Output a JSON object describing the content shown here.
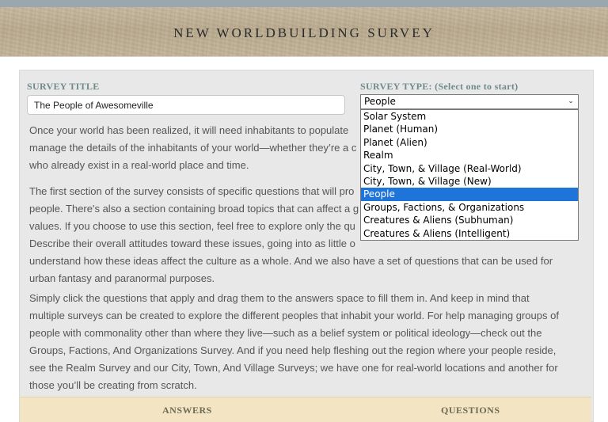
{
  "header": {
    "title": "NEW WORLDBUILDING SURVEY"
  },
  "form": {
    "survey_title_label": "SURVEY TITLE",
    "survey_title_value": "The People of Awesomeville",
    "survey_type_label": "SURVEY TYPE: (Select one to start)",
    "survey_type_value": "People",
    "survey_type_options": [
      "Solar System",
      "Planet (Human)",
      "Planet (Alien)",
      "Realm",
      "City, Town, & Village (Real-World)",
      "City, Town, & Village (New)",
      "People",
      "Groups, Factions, & Organizations",
      "Creatures & Aliens (Subhuman)",
      "Creatures & Aliens (Intelligent)"
    ]
  },
  "intro": {
    "p1": [
      "Once your world has been realized, it will need inhabitants to populate",
      "manage the details of the inhabitants of your world—whether they’re a c",
      "who already exist in a real-world place and time."
    ],
    "p2": [
      "The first section of the survey consists of specific questions that will pro",
      "people. There's also a section containing broad topics that can affect a g",
      "values. If you choose to use this section, feel free to explore only the qu",
      "Describe their overall attitudes toward these issues, going into as little o",
      "understand how these ideas affect the culture as a whole. And we also have a set of questions that can be used for",
      "urban fantasy and paranormal purposes."
    ],
    "p3": [
      "Simply click the questions that apply and drag them to the answers space to fill them in. And keep in mind that",
      "multiple surveys can be created to explore the different peoples that inhabit your world. For help managing groups of",
      "people with commonality other than where they live—such as a belief system or political ideology—check out the",
      "Groups, Factions, And Organizations Survey. And if you need help fleshing out the region where your people reside,",
      "see the Realm Survey and our City, Town, And Village Surveys; we have one for real-world locations and another for",
      "those you’ll be creating from scratch."
    ]
  },
  "columns": {
    "answers": "ANSWERS",
    "questions": "QUESTIONS"
  },
  "colors": {
    "accent_label": "#6f8a8a",
    "selected_option": "#1e74d8",
    "answers_bar": "#f3e5c3"
  }
}
